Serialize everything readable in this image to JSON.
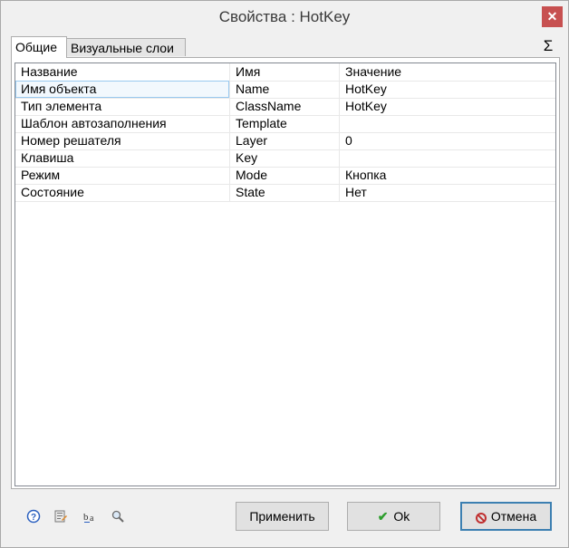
{
  "window": {
    "title": "Свойства : HotKey",
    "close_glyph": "✕"
  },
  "tabs": [
    {
      "label": "Общие",
      "active": true
    },
    {
      "label": "Визуальные слои",
      "active": false
    }
  ],
  "sigma_glyph": "Σ",
  "grid": {
    "headers": [
      "Название",
      "Имя",
      "Значение"
    ],
    "rows": [
      {
        "title": "Имя объекта",
        "name": "Name",
        "value": "HotKey"
      },
      {
        "title": "Тип элемента",
        "name": "ClassName",
        "value": "HotKey"
      },
      {
        "title": "Шаблон автозаполнения",
        "name": "Template",
        "value": ""
      },
      {
        "title": "Номер решателя",
        "name": "Layer",
        "value": "0"
      },
      {
        "title": "Клавиша",
        "name": "Key",
        "value": ""
      },
      {
        "title": "Режим",
        "name": "Mode",
        "value": "Кнопка"
      },
      {
        "title": "Состояние",
        "name": "State",
        "value": "Нет"
      }
    ]
  },
  "footer": {
    "icons": [
      "help-icon",
      "settings-edit-icon",
      "rename-icon",
      "search-icon"
    ],
    "apply_label": "Применить",
    "ok_label": "Ok",
    "cancel_label": "Отмена"
  }
}
